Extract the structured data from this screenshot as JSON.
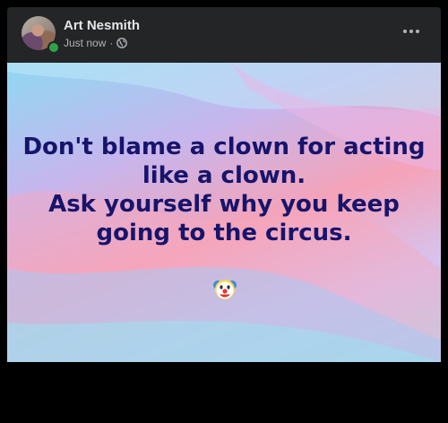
{
  "post": {
    "author": "Art Nesmith",
    "timestamp": "Just now",
    "separator": "·",
    "privacy_icon": "globe-icon",
    "menu_icon": "more-options-icon",
    "quote_lines": [
      "Don't blame a clown for acting",
      "like a clown.",
      "Ask yourself why you keep",
      "going to the circus."
    ],
    "emoji_icon": "clown-face-icon"
  },
  "colors": {
    "card_bg": "#242526",
    "name_text": "#e4e6eb",
    "meta_text": "#b0b3b8",
    "online_status": "#31a24c",
    "quote_text": "#17146b"
  }
}
